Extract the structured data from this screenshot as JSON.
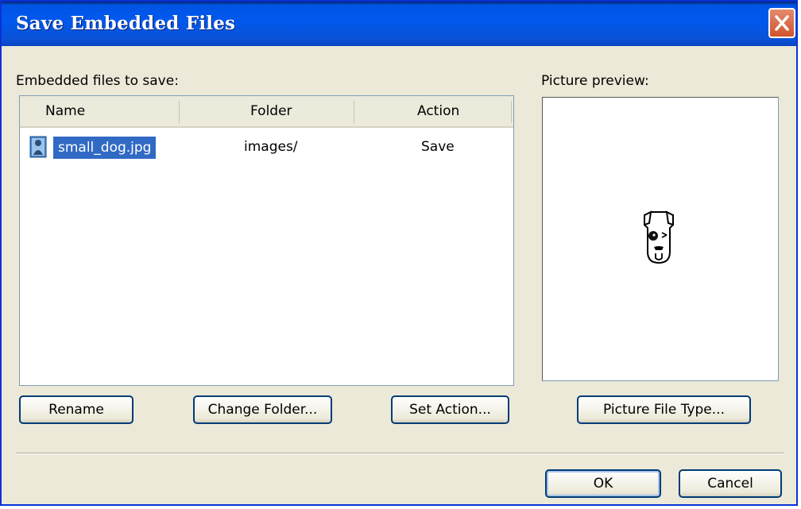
{
  "window": {
    "title": "Save Embedded Files"
  },
  "labels": {
    "embedded_files": "Embedded files to save:",
    "picture_preview": "Picture preview:"
  },
  "file_list": {
    "columns": [
      "Name",
      "Folder",
      "Action"
    ],
    "rows": [
      {
        "name": "small_dog.jpg",
        "folder": "images/",
        "action": "Save",
        "selected": true
      }
    ]
  },
  "buttons": {
    "rename": "Rename",
    "change_folder": "Change Folder...",
    "set_action": "Set Action...",
    "picture_file_type": "Picture File Type...",
    "ok": "OK",
    "cancel": "Cancel"
  },
  "icons": {
    "close": "close-icon",
    "file": "image-file-icon",
    "preview": "dog-image"
  },
  "colors": {
    "titlebar": "#0058ee",
    "close_button": "#d0532c",
    "selection": "#316ac5",
    "dialog_background": "#ece9d8"
  }
}
